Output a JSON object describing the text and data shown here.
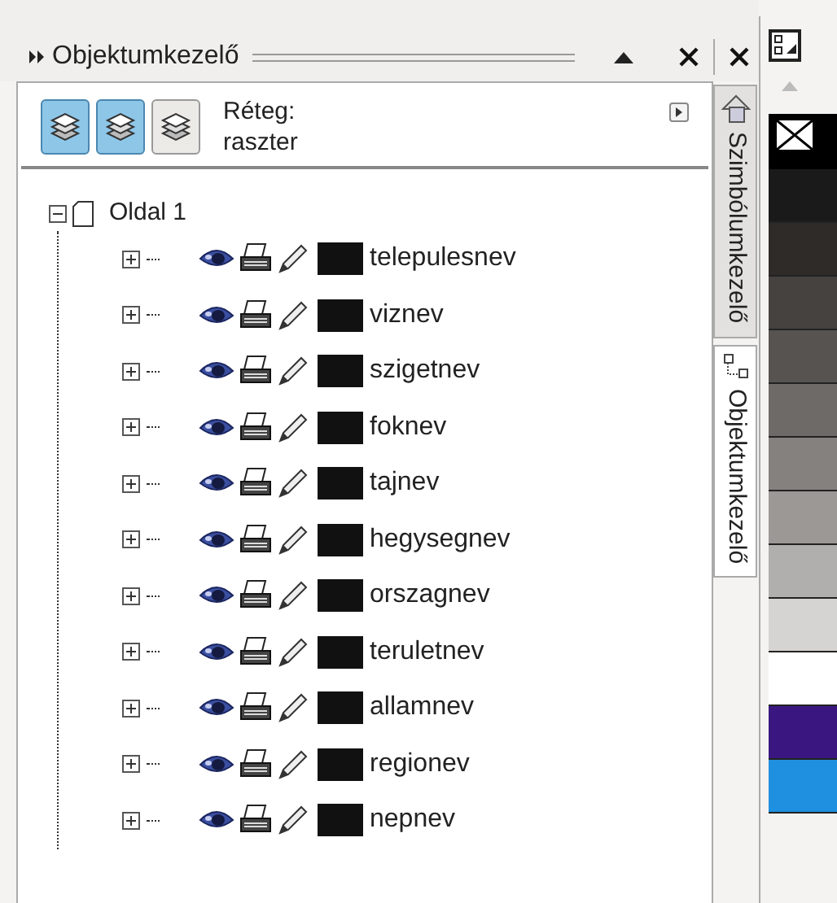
{
  "docker": {
    "title": "Objektumkezelő"
  },
  "toolbar": {
    "buttons": [
      {
        "selected": true
      },
      {
        "selected": true
      },
      {
        "selected": false
      }
    ],
    "layer_label": "Réteg:",
    "layer_value": "raszter"
  },
  "tree": {
    "label": "Oldal 1",
    "expanded": true,
    "children": [
      {
        "name": "telepulesnev",
        "visible": true,
        "printable": true,
        "editable": true,
        "color": "#111111"
      },
      {
        "name": "viznev",
        "visible": true,
        "printable": true,
        "editable": true,
        "color": "#111111"
      },
      {
        "name": "szigetnev",
        "visible": true,
        "printable": true,
        "editable": true,
        "color": "#111111"
      },
      {
        "name": "foknev",
        "visible": true,
        "printable": true,
        "editable": true,
        "color": "#111111"
      },
      {
        "name": "tajnev",
        "visible": true,
        "printable": true,
        "editable": true,
        "color": "#111111"
      },
      {
        "name": "hegysegnev",
        "visible": true,
        "printable": true,
        "editable": true,
        "color": "#111111"
      },
      {
        "name": "orszagnev",
        "visible": true,
        "printable": true,
        "editable": true,
        "color": "#111111"
      },
      {
        "name": "teruletnev",
        "visible": true,
        "printable": true,
        "editable": true,
        "color": "#111111"
      },
      {
        "name": "allamnev",
        "visible": true,
        "printable": true,
        "editable": true,
        "color": "#111111"
      },
      {
        "name": "regionev",
        "visible": true,
        "printable": true,
        "editable": true,
        "color": "#111111"
      },
      {
        "name": "nepnev",
        "visible": true,
        "printable": true,
        "editable": true,
        "color": "#111111"
      }
    ]
  },
  "side_tabs": [
    {
      "label": "Szimbólumkezelő",
      "selected": false
    },
    {
      "label": "Objektumkezelő",
      "selected": true
    }
  ],
  "palette": [
    {
      "kind": "none"
    },
    {
      "kind": "color",
      "color": "#1a1a1a"
    },
    {
      "kind": "color",
      "color": "#2e2b29"
    },
    {
      "kind": "color",
      "color": "#46423f"
    },
    {
      "kind": "color",
      "color": "#575350"
    },
    {
      "kind": "color",
      "color": "#6d6a67"
    },
    {
      "kind": "color",
      "color": "#85817e"
    },
    {
      "kind": "color",
      "color": "#9b9896"
    },
    {
      "kind": "color",
      "color": "#b1afad"
    },
    {
      "kind": "color",
      "color": "#d6d4d2"
    },
    {
      "kind": "color",
      "color": "#ffffff"
    },
    {
      "kind": "color",
      "color": "#3a1780"
    },
    {
      "kind": "color",
      "color": "#1f8fe0"
    }
  ]
}
